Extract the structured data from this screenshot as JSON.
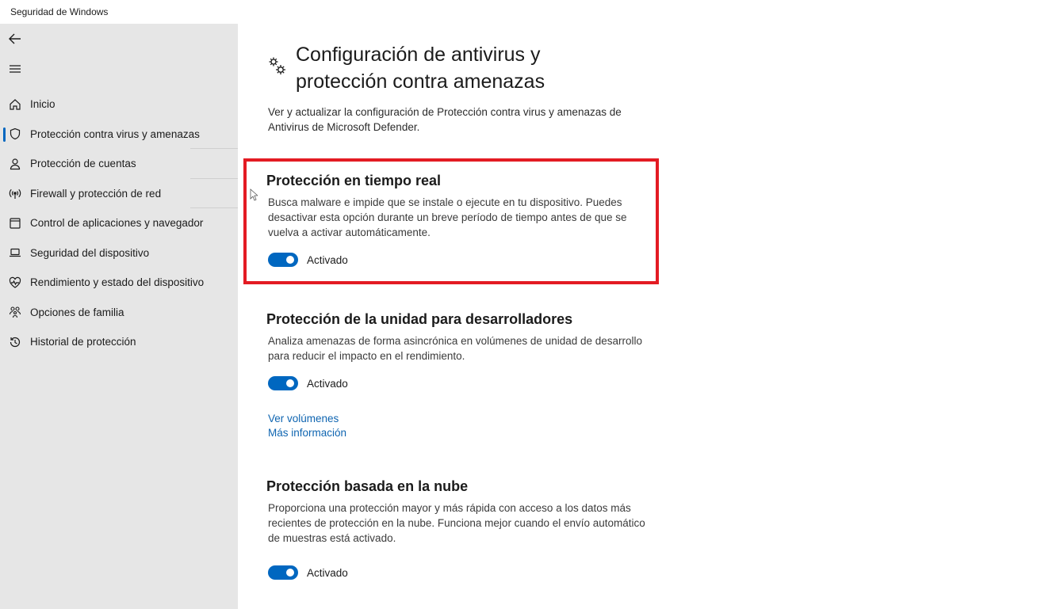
{
  "window": {
    "title": "Seguridad de Windows"
  },
  "sidebar": {
    "items": [
      {
        "label": "Inicio",
        "icon": "home-icon"
      },
      {
        "label": "Protección contra virus y amenazas",
        "icon": "shield-icon",
        "selected": true
      },
      {
        "label": "Protección de cuentas",
        "icon": "person-icon"
      },
      {
        "label": "Firewall y protección de red",
        "icon": "wifi-signal-icon"
      },
      {
        "label": "Control de aplicaciones y navegador",
        "icon": "app-window-icon"
      },
      {
        "label": "Seguridad del dispositivo",
        "icon": "laptop-icon"
      },
      {
        "label": "Rendimiento y estado del dispositivo",
        "icon": "heart-pulse-icon"
      },
      {
        "label": "Opciones de familia",
        "icon": "family-icon"
      },
      {
        "label": "Historial de protección",
        "icon": "history-icon"
      }
    ]
  },
  "main": {
    "title": "Configuración de antivirus y protección contra amenazas",
    "description": "Ver y actualizar la configuración de Protección contra virus y amenazas de Antivirus de Microsoft Defender.",
    "sections": [
      {
        "heading": "Protección en tiempo real",
        "description": "Busca malware e impide que se instale o ejecute en tu dispositivo. Puedes desactivar esta opción durante un breve período de tiempo antes de que se vuelva a activar automáticamente.",
        "toggle_label": "Activado"
      },
      {
        "heading": "Protección de la unidad para desarrolladores",
        "description": "Analiza amenazas de forma asincrónica en volúmenes de unidad de desarrollo para reducir el impacto en el rendimiento.",
        "toggle_label": "Activado",
        "links": [
          "Ver volúmenes",
          "Más información"
        ]
      },
      {
        "heading": "Protección basada en la nube",
        "description": "Proporciona una protección mayor y más rápida con acceso a los datos más recientes de protección en la nube. Funciona mejor cuando el envío automático de muestras está activado.",
        "toggle_label": "Activado"
      }
    ]
  },
  "colors": {
    "accent": "#0067c0",
    "highlight": "#e31b23",
    "sidebar_bg": "#e6e6e6",
    "link": "#0f65b1"
  }
}
